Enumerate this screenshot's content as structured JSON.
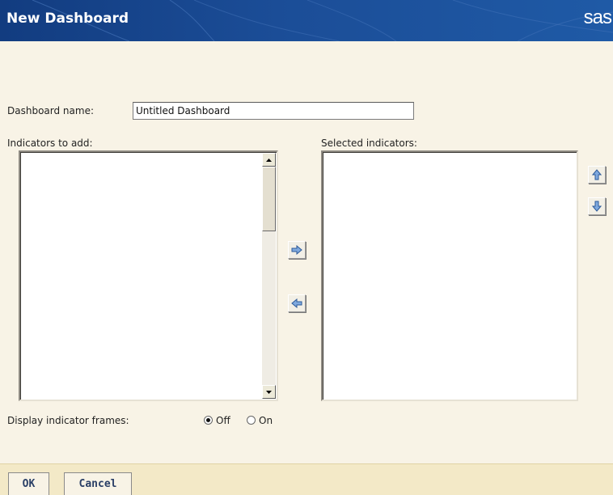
{
  "window": {
    "title": "New Dashboard",
    "logo": "sas"
  },
  "form": {
    "dashboard_name_label": "Dashboard name:",
    "dashboard_name_value": "Untitled Dashboard",
    "indicators_to_add_label": "Indicators to add:",
    "selected_indicators_label": "Selected indicators:",
    "display_frames_label": "Display indicator frames:",
    "radio_options": [
      {
        "label": "Off",
        "selected": true
      },
      {
        "label": "On",
        "selected": false
      }
    ]
  },
  "icons": {
    "add": "arrow-right-icon",
    "remove": "arrow-left-icon",
    "move_up": "arrow-up-icon",
    "move_down": "arrow-down-icon"
  },
  "footer": {
    "ok_label": "OK",
    "cancel_label": "Cancel"
  },
  "colors": {
    "titlebar": "#1b4d97",
    "background": "#f8f3e6",
    "footer": "#f3e9c7",
    "button_text": "#2a3f66"
  }
}
